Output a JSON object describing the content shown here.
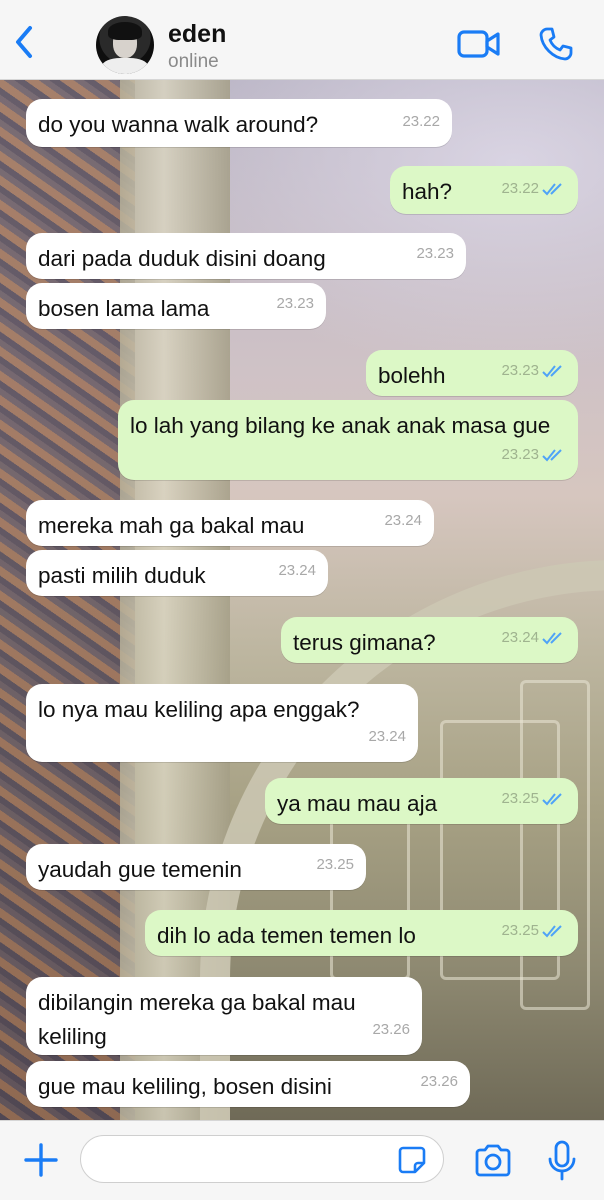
{
  "header": {
    "contact_name": "eden",
    "status": "online",
    "icons": [
      "back-chevron-icon",
      "video-call-icon",
      "phone-call-icon"
    ],
    "accent_color": "#1a7cf5"
  },
  "messages": [
    {
      "dir": "in",
      "text": "do you wanna walk around?",
      "time": "23.22"
    },
    {
      "dir": "out",
      "text": "hah?",
      "time": "23.22",
      "read": true
    },
    {
      "dir": "in",
      "text": "dari pada duduk disini doang",
      "time": "23.23"
    },
    {
      "dir": "in",
      "text": "bosen lama lama",
      "time": "23.23"
    },
    {
      "dir": "out",
      "text": "bolehh",
      "time": "23.23",
      "read": true
    },
    {
      "dir": "out",
      "text": "lo lah yang bilang ke anak anak masa gue",
      "time": "23.23",
      "read": true
    },
    {
      "dir": "in",
      "text": "mereka mah ga bakal mau",
      "time": "23.24"
    },
    {
      "dir": "in",
      "text": "pasti milih duduk",
      "time": "23.24"
    },
    {
      "dir": "out",
      "text": "terus gimana?",
      "time": "23.24",
      "read": true
    },
    {
      "dir": "in",
      "text": "lo nya mau keliling apa enggak?",
      "time": "23.24"
    },
    {
      "dir": "out",
      "text": "ya mau mau aja",
      "time": "23.25",
      "read": true
    },
    {
      "dir": "in",
      "text": "yaudah gue temenin",
      "time": "23.25"
    },
    {
      "dir": "out",
      "text": "dih lo ada temen temen lo",
      "time": "23.25",
      "read": true
    },
    {
      "dir": "in",
      "text": "dibilangin mereka ga bakal mau keliling",
      "time": "23.26"
    },
    {
      "dir": "in",
      "text": "gue mau keliling, bosen disini",
      "time": "23.26"
    }
  ],
  "colors": {
    "incoming_bubble": "#ffffff",
    "outgoing_bubble": "#dcf8c6",
    "read_ticks": "#4fa3f7"
  },
  "input": {
    "value": "",
    "icons": [
      "plus-icon",
      "sticker-icon",
      "camera-icon",
      "microphone-icon"
    ]
  }
}
